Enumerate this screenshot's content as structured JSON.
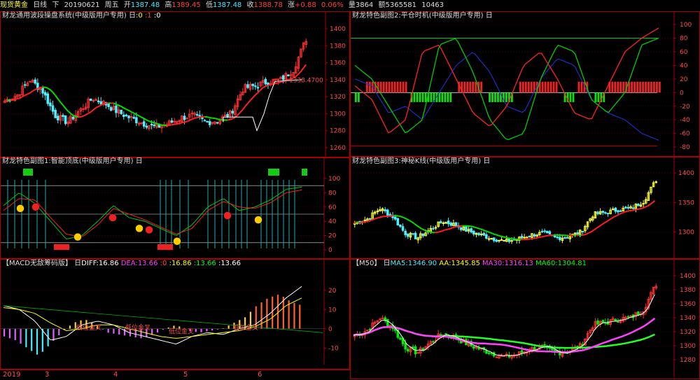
{
  "topbar": {
    "name": "现货黄金",
    "period": "日线",
    "sub": "下",
    "date": "20190621",
    "weekday": "周五",
    "open_label": "开",
    "open": "1387.48",
    "high_label": "高",
    "high": "1389.45",
    "low_label": "低",
    "low": "1387.48",
    "close_label": "收",
    "close": "1388.78",
    "chg_label": "涨",
    "chg": "+0.88",
    "pct": "0.06%",
    "vol_label": "量",
    "vol": "3864",
    "amt_label": "额",
    "amt": "5365581",
    "extra": "10463"
  },
  "panels": {
    "main": {
      "title": "财龙通用波段操盘系统(中级版用户专用)",
      "mark": "日",
      "v1": ":0",
      "v2": ":1",
      "v3": ":0",
      "annotation": "1338.4700",
      "yticks": [
        "1400",
        "1380",
        "1360",
        "1340",
        "1320",
        "1300",
        "1280",
        "1260"
      ]
    },
    "sub1": {
      "title": "财龙特色副图1:智能顶底(中级版用户专用)",
      "mark": "日",
      "yticks": [
        "100",
        "80",
        "60",
        "40",
        "20",
        "0"
      ]
    },
    "macd": {
      "title": "【MACD无敌筹码版】",
      "mark": "日",
      "diff_label": "DIFF:",
      "diff": "16.86",
      "dea_label": "DEA:",
      "dea": "13.66",
      "z_label": ":",
      "z": "0",
      "a": ":16.86",
      "b": ":13.66",
      "c": ":13.66",
      "cross_labels": [
        "低位金叉",
        "低位金叉",
        "低位金叉",
        "低位金叉"
      ],
      "yticks": [
        "20",
        "10",
        "0",
        "-10"
      ]
    },
    "sub2": {
      "title": "财龙特色副图2:平仓时机(中级版用户专用)",
      "mark": "日",
      "yticks": [
        "100",
        "80",
        "60",
        "40",
        "20",
        "0",
        "-20",
        "-40",
        "-60",
        "-80"
      ]
    },
    "sub3": {
      "title": "财龙特色副图3:神秘K线(中级版用户专用)",
      "mark": "日",
      "yticks": [
        "1400",
        "1350",
        "1300"
      ]
    },
    "m50": {
      "title": "【M50】",
      "mark": "日",
      "ma5_label": "MA5:",
      "ma5": "1346.90",
      "aa_label": "AA:",
      "aa": "1345.85",
      "ma30_label": "MA30:",
      "ma30": "1316.13",
      "ma60_label": "MA60:",
      "ma60": "1304.81",
      "yticks": [
        "1400",
        "1380",
        "1360",
        "1340",
        "1320",
        "1300",
        "1280"
      ]
    }
  },
  "xaxis": {
    "labels": [
      "2019",
      "3",
      "4",
      "5",
      "6"
    ]
  },
  "colors": {
    "up": "#ff3030",
    "down": "#4ef0ff",
    "ma_green": "#00e000",
    "ma_red": "#ff2020",
    "magenta": "#ff40ff",
    "frame": "#aa0000",
    "yellow": "#ffff40"
  },
  "chart_data": [
    {
      "type": "line",
      "name": "price-candles",
      "x": [
        0,
        5,
        10,
        15,
        20,
        25,
        30,
        35,
        40,
        45,
        50,
        55,
        60,
        65,
        70,
        75,
        80,
        85,
        90,
        95,
        100,
        105,
        110,
        115,
        120
      ],
      "close": [
        1315,
        1322,
        1340,
        1327,
        1298,
        1290,
        1304,
        1318,
        1312,
        1302,
        1295,
        1289,
        1284,
        1288,
        1295,
        1298,
        1290,
        1292,
        1300,
        1330,
        1333,
        1338,
        1340,
        1352,
        1388
      ],
      "ylim": [
        1255,
        1405
      ]
    },
    {
      "type": "line",
      "name": "ping-cang",
      "ylim": [
        -85,
        100
      ]
    },
    {
      "type": "bar",
      "name": "macd",
      "ylim": [
        -15,
        25
      ]
    }
  ]
}
